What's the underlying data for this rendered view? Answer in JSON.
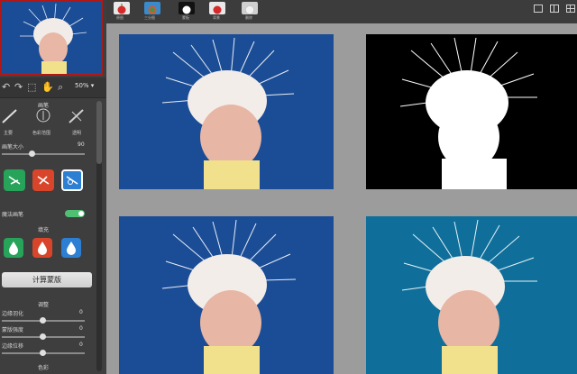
{
  "sidebar": {
    "zoom": "50% ▾",
    "brush_section": "画笔",
    "brush_labels": [
      "主要",
      "色彩范围",
      "透明"
    ],
    "brush_size_label": "画笔大小",
    "brush_size_value": "90",
    "magic_brush_label": "魔法画笔",
    "fill_section": "填充",
    "compute_button": "计算蒙版",
    "adjust_section": "调整",
    "adjustments": [
      {
        "label": "边缘羽化",
        "value": "0"
      },
      {
        "label": "蒙版强度",
        "value": "0"
      },
      {
        "label": "边缘位移",
        "value": "0"
      }
    ],
    "color_section": "色彩"
  },
  "toolbar": {
    "tabs": [
      "原图",
      "三分图",
      "蒙板",
      "背景",
      "删除"
    ]
  },
  "colors": {
    "blue_bg": "#1b4d96",
    "teal_bg": "#0f6f9a",
    "green": "#27a35a",
    "red": "#d8452a",
    "blue_btn": "#2d7fd3"
  }
}
